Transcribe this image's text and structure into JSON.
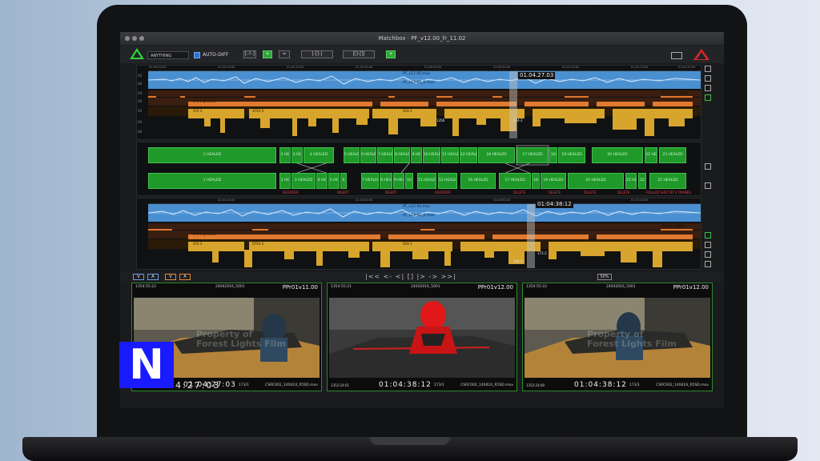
{
  "app": {
    "window_title": "Matchbox · PF_v12.00_fr_11.02",
    "toolbar": {
      "selector_value": "ANYTHING",
      "autodiff_label": "AUTO-DIFF",
      "buttons": [
        "[-?-]",
        "+",
        "=",
        "|-[]-|",
        "|[]-[]|",
        "+"
      ]
    },
    "timeline_top": {
      "ruler_times": [
        "01:00:00:00",
        "01:00:10:00",
        "01:00:20:00",
        "01:00:30:00",
        "01:00:40:00",
        "01:00:50:00",
        "01:01:00:00",
        "01:01:10:00",
        "01:01:20:00"
      ],
      "track_labels": [
        "A1",
        "A2",
        "V3",
        "V2",
        "V1",
        "A1",
        "A2"
      ],
      "audio_file_1": "PF_v11.00.mov",
      "audio_file_2": "PF_v11.00_fr.mov",
      "clip_labels": [
        "SYS-2 pinks01",
        "SYS 3",
        "SYSA 4",
        "SSA-1",
        "1356",
        "144-2",
        "PP_ELLS_14RSV"
      ],
      "timecode": "01.04.27.03"
    },
    "diff_panel": {
      "row1": [
        "1 HEALED",
        "2 HE",
        "3 HE",
        "4 HEALED",
        "5 HEALE",
        "6 HEALE",
        "7 HEALE",
        "8 HEALE",
        "9 HE",
        "10 HEALE",
        "11 HEALE",
        "12 HEALE",
        "16 HEALED",
        "17 HEALED",
        "18",
        "19 HEALED",
        "20 HEALED",
        "22 HE",
        "23 HEALED"
      ],
      "row2": [
        "1 HEALED",
        "2 HE",
        "3 HEALED",
        "4 HE",
        "5 HE",
        "6",
        "7 HEALED",
        "8 HEA",
        "9 HEA",
        "10",
        "11 HEALED",
        "12 HEALED",
        "16 HEALED",
        "17 HEALED",
        "18",
        "19 HEALED",
        "20 HEALED",
        "21 HE",
        "22",
        "25 HEALED"
      ],
      "changes": [
        "REORDER",
        "INSERT",
        "INSERT",
        "REORDER",
        "DELETE",
        "DELETE",
        "DELETE",
        "DELETE",
        "ROLLED SHOT BY 4 FRAMES"
      ]
    },
    "timeline_bottom": {
      "ruler_times": [
        "01:00:00:00",
        "01:00:10:00",
        "01:00:20:00",
        "01:00:30:00",
        "01:00:40:00",
        "01:00:50:00",
        "01:01:00:00",
        "01:01:10:00",
        "01:01:20:00"
      ],
      "audio_file_1": "PF_v12.00.mov",
      "audio_file_2": "PF_v12.00_fr.mov",
      "clip_labels": [
        "SYS-2 pinks01",
        "SYS 3",
        "SYSA 4",
        "SSA-1",
        "172-2",
        "144-2",
        "PF_SO_REMAS"
      ],
      "timecode": "01:04:38:12"
    },
    "transport": {
      "chips": [
        "V",
        "A",
        "V",
        "A"
      ],
      "glyphs": "|<< <- <| [] |> -> >>| ",
      "zoom": "50%"
    },
    "viewers": [
      {
        "tc_left": "1354:55:22",
        "date": "24042016_5001",
        "name": "PPr01v11.00",
        "tc": "01:04:27:03",
        "frame_no": "173/1",
        "file": "CSRC002_140424_R5SD.mov",
        "tc_small": "1352:24:69"
      },
      {
        "tc_left": "1354:55:21",
        "date": "24042016_5001",
        "name": "PPr01v12.00",
        "tc": "01:04:38:12",
        "frame_no": "173/1",
        "file": "CSRC002_140424_R5SD.mov",
        "tc_small": "1352:24:01"
      },
      {
        "tc_left": "1354:55:22",
        "date": "24042016_5001",
        "name": "PPr01v12.00",
        "tc": "01:04:38:12",
        "frame_no": "173/1",
        "file": "CSRC002_140424_R5SD.mov",
        "tc_small": "1352:24:69"
      }
    ],
    "watermark": [
      "Property of",
      "Forest Lights Film"
    ],
    "overlay": {
      "logo_letter": "N",
      "timecode": "4:27:03"
    }
  },
  "colors": {
    "accent": "#2fd33a",
    "alert": "#d8282a",
    "audio": "#4a8fd0",
    "clip_orange": "#e0772e",
    "clip_gold": "#d7a52c",
    "diff_green": "#1f9a2a"
  }
}
